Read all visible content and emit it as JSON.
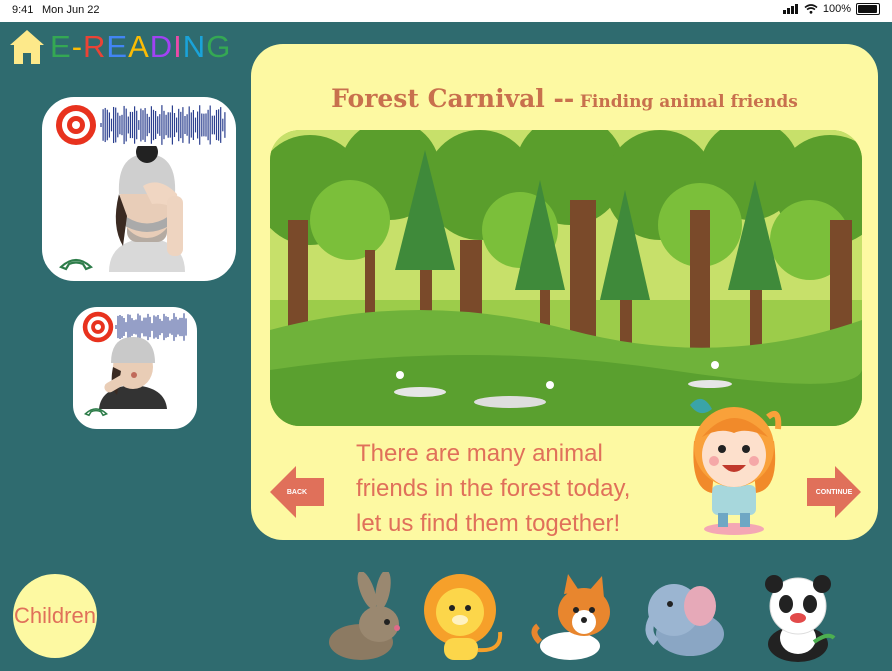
{
  "status_bar": {
    "time": "9:41",
    "date": "Mon Jun 22",
    "battery": "100%"
  },
  "brand": {
    "letters": [
      {
        "ch": "E",
        "color": "#34a853"
      },
      {
        "ch": "-",
        "color": "#fbbc05"
      },
      {
        "ch": "R",
        "color": "#ea4335"
      },
      {
        "ch": "E",
        "color": "#4285f4"
      },
      {
        "ch": "A",
        "color": "#fbbc05"
      },
      {
        "ch": "D",
        "color": "#a142f4"
      },
      {
        "ch": "I",
        "color": "#e94aa8"
      },
      {
        "ch": "N",
        "color": "#1aa3d9"
      },
      {
        "ch": "G",
        "color": "#34a853"
      }
    ]
  },
  "story": {
    "title_main": "Forest Carnival --",
    "title_sub": "Finding animal friends",
    "text_lines": [
      "There are many animal",
      "friends in the forest today,",
      "let us find them together!"
    ],
    "back_label": "BACK",
    "continue_label": "CONTINUE"
  },
  "role": {
    "label": "Children"
  },
  "animals": [
    "rabbit-icon",
    "lion-icon",
    "corgi-icon",
    "elephant-icon",
    "panda-icon"
  ],
  "colors": {
    "background": "#2f6b6f",
    "panel": "#fdf9a2",
    "accent": "#e0705a",
    "title": "#c8704d"
  }
}
